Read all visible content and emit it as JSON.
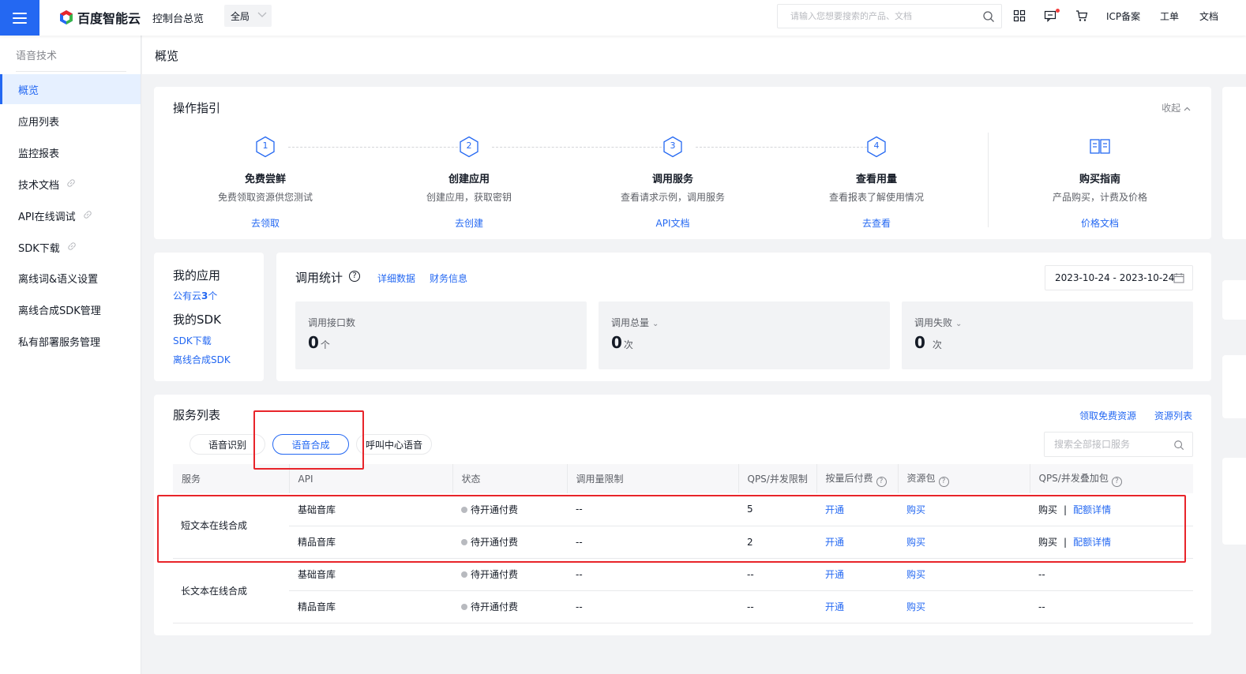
{
  "topbar": {
    "brand": "百度智能云",
    "console_label": "控制台总览",
    "region": "全局",
    "search_placeholder": "请输入您想要搜索的产品、文档",
    "links": {
      "icp": "ICP备案",
      "ticket": "工单",
      "docs": "文档"
    },
    "accent": "#2468f2"
  },
  "sidebar": {
    "title": "语音技术",
    "items": [
      {
        "label": "概览",
        "active": true
      },
      {
        "label": "应用列表"
      },
      {
        "label": "监控报表"
      },
      {
        "label": "技术文档",
        "external": true
      },
      {
        "label": "API在线调试",
        "external": true
      },
      {
        "label": "SDK下载",
        "external": true
      },
      {
        "label": "离线词&语义设置"
      },
      {
        "label": "离线合成SDK管理"
      },
      {
        "label": "私有部署服务管理"
      }
    ]
  },
  "page": {
    "title": "概览"
  },
  "guide": {
    "title": "操作指引",
    "collapse_label": "收起",
    "steps": [
      {
        "num": "1",
        "title": "免费尝鲜",
        "desc": "免费领取资源供您测试",
        "link": "去领取"
      },
      {
        "num": "2",
        "title": "创建应用",
        "desc": "创建应用，获取密钥",
        "link": "去创建"
      },
      {
        "num": "3",
        "title": "调用服务",
        "desc": "查看请求示例，调用服务",
        "link": "API文档"
      },
      {
        "num": "4",
        "title": "查看用量",
        "desc": "查看报表了解使用情况",
        "link": "去查看"
      }
    ],
    "purchase": {
      "title": "购买指南",
      "desc": "产品购买，计费及价格",
      "link": "价格文档"
    }
  },
  "my_apps": {
    "title": "我的应用",
    "public_cloud_prefix": "公有云",
    "public_cloud_count": "3",
    "public_cloud_suffix": "个",
    "sdk_title": "我的SDK",
    "sdk_download": "SDK下载",
    "offline_sdk": "离线合成SDK"
  },
  "stats": {
    "title": "调用统计",
    "detail_link": "详细数据",
    "finance_link": "财务信息",
    "date_range": "2023-10-24 - 2023-10-24",
    "boxes": [
      {
        "label": "调用接口数",
        "value": "0",
        "unit": "个",
        "dropdown": false
      },
      {
        "label": "调用总量",
        "value": "0",
        "unit": "次",
        "dropdown": true
      },
      {
        "label": "调用失败",
        "value": "0",
        "unit": "次",
        "dropdown": true
      }
    ]
  },
  "services": {
    "title": "服务列表",
    "free_link": "领取免费资源",
    "resource_link": "资源列表",
    "tabs": [
      "语音识别",
      "语音合成",
      "呼叫中心语音"
    ],
    "active_tab": "语音合成",
    "search_placeholder": "搜索全部接口服务",
    "columns": [
      "服务",
      "API",
      "状态",
      "调用量限制",
      "QPS/并发限制",
      "按量后付费",
      "资源包",
      "QPS/并发叠加包"
    ],
    "groups": [
      {
        "name": "短文本在线合成",
        "rows": [
          {
            "api": "基础音库",
            "status": "待开通付费",
            "limit": "--",
            "qps": "5",
            "postpaid": "开通",
            "package": "购买",
            "addon_buy": "购买",
            "addon_detail": "配额详情"
          },
          {
            "api": "精品音库",
            "status": "待开通付费",
            "limit": "--",
            "qps": "2",
            "postpaid": "开通",
            "package": "购买",
            "addon_buy": "购买",
            "addon_detail": "配额详情"
          }
        ]
      },
      {
        "name": "长文本在线合成",
        "rows": [
          {
            "api": "基础音库",
            "status": "待开通付费",
            "limit": "--",
            "qps": "--",
            "postpaid": "开通",
            "package": "购买",
            "addon": "--"
          },
          {
            "api": "精品音库",
            "status": "待开通付费",
            "limit": "--",
            "qps": "--",
            "postpaid": "开通",
            "package": "购买",
            "addon": "--"
          }
        ]
      }
    ]
  }
}
